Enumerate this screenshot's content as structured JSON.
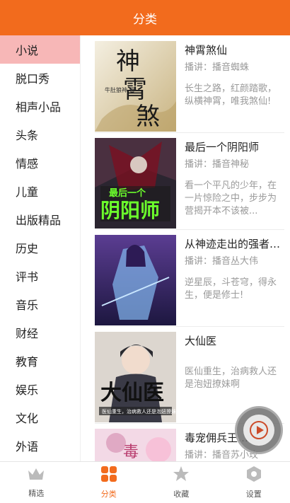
{
  "header": {
    "title": "分类"
  },
  "categories": [
    {
      "label": "小说",
      "active": true
    },
    {
      "label": "脱口秀",
      "active": false
    },
    {
      "label": "相声小品",
      "active": false
    },
    {
      "label": "头条",
      "active": false
    },
    {
      "label": "情感",
      "active": false
    },
    {
      "label": "儿童",
      "active": false
    },
    {
      "label": "出版精品",
      "active": false
    },
    {
      "label": "历史",
      "active": false
    },
    {
      "label": "评书",
      "active": false
    },
    {
      "label": "音乐",
      "active": false
    },
    {
      "label": "财经",
      "active": false
    },
    {
      "label": "教育",
      "active": false
    },
    {
      "label": "娱乐",
      "active": false
    },
    {
      "label": "文化",
      "active": false
    },
    {
      "label": "外语",
      "active": false
    }
  ],
  "books": [
    {
      "title": "神霄煞仙",
      "narrator": "播讲：播音蜘蛛",
      "description": "长生之路，红颜踏歌，纵横神霄，唯我煞仙!",
      "cover_text": "神霄煞仙",
      "cover_author": "牛肚狼神 著",
      "cover_colors": [
        "#f2ead8",
        "#cbb98f"
      ]
    },
    {
      "title": "最后一个阴阳师",
      "narrator": "播讲：播音神秘",
      "description": "看一个平凡的少年，在一片惊险之中，步步为营揭开本不该被...",
      "cover_text": "最后一个 阴阳师",
      "cover_colors": [
        "#2b2530",
        "#7a1020"
      ]
    },
    {
      "title": "从神迹走出的强者…",
      "narrator": "播讲：播音丛大伟",
      "description": "逆星辰，斗苍穹，得永生，便是修士!",
      "cover_colors": [
        "#3a2a6a",
        "#8bb6e6"
      ]
    },
    {
      "title": "大仙医",
      "narrator": "",
      "description": "医仙重生，治病救人还是泡妞撩妹啊",
      "cover_text": "大仙医",
      "cover_tagline": "医仙重生，治病救人还是泡妞撩妹",
      "cover_colors": [
        "#d7d2cc",
        "#2f2f38"
      ]
    },
    {
      "title": "毒宠佣兵王…",
      "narrator": "播讲：播音苏小玫",
      "description": "",
      "cover_colors": [
        "#f3d9e6",
        "#e0a9c4"
      ]
    }
  ],
  "tabs": [
    {
      "label": "精选",
      "icon": "crown-icon",
      "active": false
    },
    {
      "label": "分类",
      "icon": "grid-icon",
      "active": true
    },
    {
      "label": "收藏",
      "icon": "star-icon",
      "active": false
    },
    {
      "label": "设置",
      "icon": "hexagon-settings-icon",
      "active": false
    }
  ],
  "colors": {
    "accent": "#f26b1d",
    "active_category_bg": "#f7b7b7",
    "muted_text": "#9a9a9a",
    "inactive_tab_icon": "#bbbbbb"
  }
}
